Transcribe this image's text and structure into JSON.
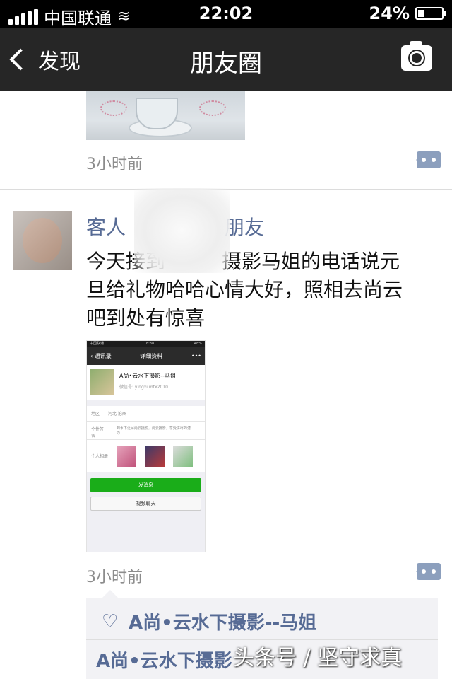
{
  "status_bar": {
    "carrier": "中国联通",
    "time": "22:02",
    "battery": "24%",
    "battery_level": 0.24
  },
  "nav": {
    "back_label": "发现",
    "title": "朋友圈"
  },
  "prev_post": {
    "time": "3小时前"
  },
  "post": {
    "username_visible": "客人",
    "username_end": "朋友",
    "text": "今天接到",
    "text_rest": "摄影马姐的电话说元旦给礼物哈哈心情大好，照相去尚云吧到处有惊喜",
    "time": "3小时前",
    "screenshot": {
      "carrier": "中国联通",
      "time": "18:38",
      "battery": "48%",
      "back_label": "通讯录",
      "title": "详细资料",
      "more": "•••",
      "name": "A尚•云水下摄影--马姐",
      "wechat_id": "微信号: yingxi.mtx2010",
      "region_label": "地区",
      "region_value": "河北 沧州",
      "signature_label": "个性签名",
      "signature_value": "到水下让另尚云摄影，尚云摄影，享受拼尽的潜力……",
      "album_label": "个人相册",
      "send_button": "发消息",
      "video_button": "视频聊天"
    },
    "likes": {
      "names": "A尚•云水下摄影--马姐"
    },
    "comment": {
      "author": "A尚•云水下摄影",
      "rest": ""
    }
  },
  "watermark": "头条号 / 坚守求真"
}
